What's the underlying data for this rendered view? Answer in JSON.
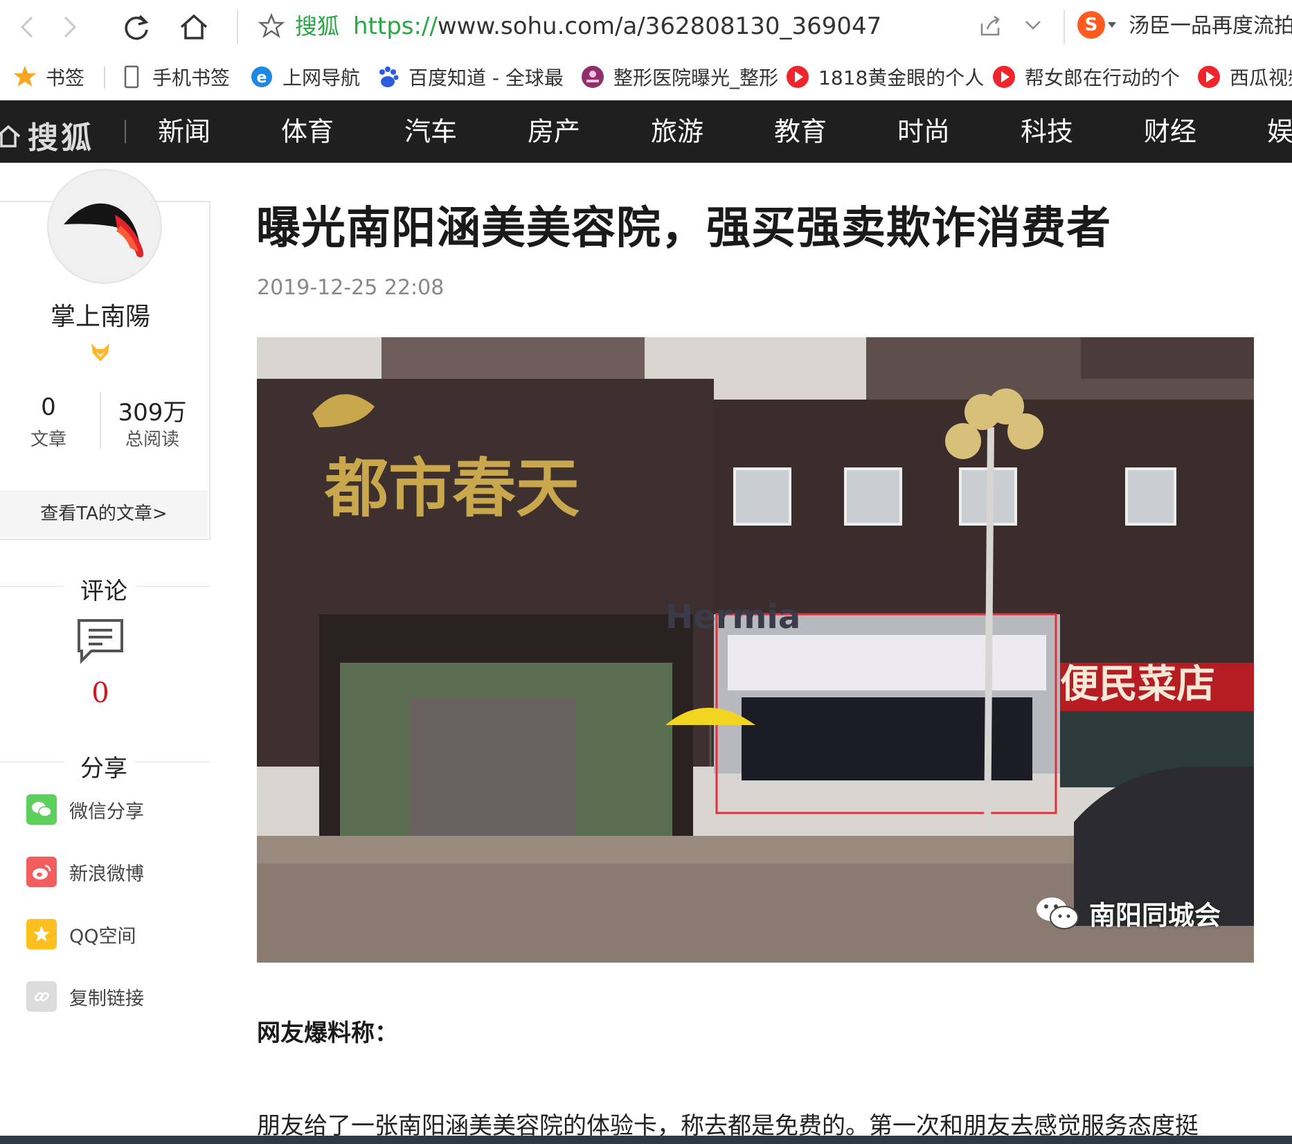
{
  "browser": {
    "url_site_label": "搜狐",
    "url_protocol": "https://",
    "url_rest": "www.sohu.com/a/362808130_369047",
    "search_hint": "汤臣一品再度流拍"
  },
  "bookmarks": [
    {
      "label": "书签",
      "icon": "star-icon"
    },
    {
      "label": "手机书签",
      "icon": "phone-icon"
    },
    {
      "label": "上网导航",
      "icon": "ie-icon"
    },
    {
      "label": "百度知道 - 全球最",
      "icon": "baidu-icon"
    },
    {
      "label": "整形医院曝光_整形",
      "icon": "hospital-icon"
    },
    {
      "label": "1818黄金眼的个人",
      "icon": "video-icon"
    },
    {
      "label": "帮女郎在行动的个",
      "icon": "video-icon"
    },
    {
      "label": "西瓜视频",
      "icon": "video-icon"
    }
  ],
  "site": {
    "logo": "搜狐",
    "nav": [
      "新闻",
      "体育",
      "汽车",
      "房产",
      "旅游",
      "教育",
      "时尚",
      "科技",
      "财经",
      "娱"
    ]
  },
  "author": {
    "name": "掌上南陽",
    "articles_count": "0",
    "articles_label": "文章",
    "reads_count": "309万",
    "reads_label": "总阅读",
    "view_articles": "查看TA的文章>"
  },
  "comments": {
    "title": "评论",
    "count": "0"
  },
  "share": {
    "title": "分享",
    "items": [
      {
        "label": "微信分享",
        "color": "#5ccf5c"
      },
      {
        "label": "新浪微博",
        "color": "#f25e5e"
      },
      {
        "label": "QQ空间",
        "color": "#ffc01f"
      },
      {
        "label": "复制链接",
        "color": "#dcdcdc"
      }
    ]
  },
  "article": {
    "title": "曝光南阳涵美美容院，强买强卖欺诈消费者",
    "date": "2019-12-25 22:08",
    "photo": {
      "sign_text": "都市春天",
      "shop_sign": "Hermia",
      "store_sign": "便民菜店",
      "watermark": "南阳同城会"
    },
    "subhead": "网友爆料称：",
    "paragraph": "朋友给了一张南阳涵美美容院的体验卡，称去都是免费的。第一次和朋友去感觉服务态度挺"
  },
  "colors": {
    "nav_bg": "#1f1f1f",
    "accent_green": "#28a745",
    "comment_red": "#d4181b"
  }
}
